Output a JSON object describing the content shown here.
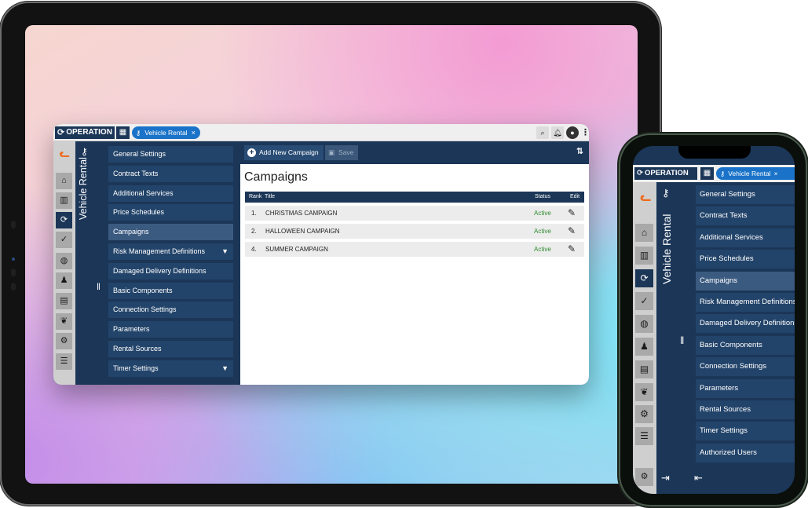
{
  "tablet": {
    "topbar": {
      "brand": "OPERATION",
      "grid_icon": "apps-grid-icon",
      "tab_label": "Vehicle Rental",
      "tab_close": "×",
      "icons": [
        "search-icon",
        "bell-icon",
        "user-icon",
        "more-icon"
      ]
    },
    "module_title": "Vehicle Rental",
    "menu": [
      {
        "label": "General Settings"
      },
      {
        "label": "Contract Texts"
      },
      {
        "label": "Additional Services"
      },
      {
        "label": "Price Schedules"
      },
      {
        "label": "Campaigns",
        "active": true
      },
      {
        "label": "Risk Management Definitions",
        "expandable": true
      },
      {
        "label": "Damaged Delivery Definitions"
      },
      {
        "label": "Basic Components"
      },
      {
        "label": "Connection Settings"
      },
      {
        "label": "Parameters"
      },
      {
        "label": "Rental Sources"
      },
      {
        "label": "Timer Settings",
        "expandable": true
      }
    ],
    "toolbar": {
      "add_label": "Add New Campaign",
      "save_label": "Save"
    },
    "page_title": "Campaigns",
    "table": {
      "columns": [
        "Rank",
        "Title",
        "Status",
        "Edit"
      ],
      "rows": [
        {
          "rank": "1.",
          "title": "CHRISTMAS CAMPAIGN",
          "status": "Active"
        },
        {
          "rank": "2.",
          "title": "HALLOWEEN CAMPAIGN",
          "status": "Active"
        },
        {
          "rank": "4.",
          "title": "SUMMER CAMPAIGN",
          "status": "Active"
        }
      ]
    }
  },
  "phone": {
    "brand": "OPERATION",
    "tab_label": "Vehicle Rental",
    "tab_close": "×",
    "module_title": "Vehicle Rental",
    "menu": [
      {
        "label": "General Settings"
      },
      {
        "label": "Contract Texts"
      },
      {
        "label": "Additional Services"
      },
      {
        "label": "Price Schedules"
      },
      {
        "label": "Campaigns",
        "active": true
      },
      {
        "label": "Risk Management Definitions"
      },
      {
        "label": "Damaged Delivery Definitions"
      },
      {
        "label": "Basic Components"
      },
      {
        "label": "Connection Settings"
      },
      {
        "label": "Parameters"
      },
      {
        "label": "Rental Sources"
      },
      {
        "label": "Timer Settings"
      },
      {
        "label": "Authorized Users"
      }
    ]
  },
  "colors": {
    "navy": "#1b3657",
    "menu_item": "#23446a",
    "active_item": "#3b5a80",
    "chip_blue": "#1a73c8",
    "status_green": "#2e8b2e",
    "brand_orange": "#ef6b1e"
  }
}
